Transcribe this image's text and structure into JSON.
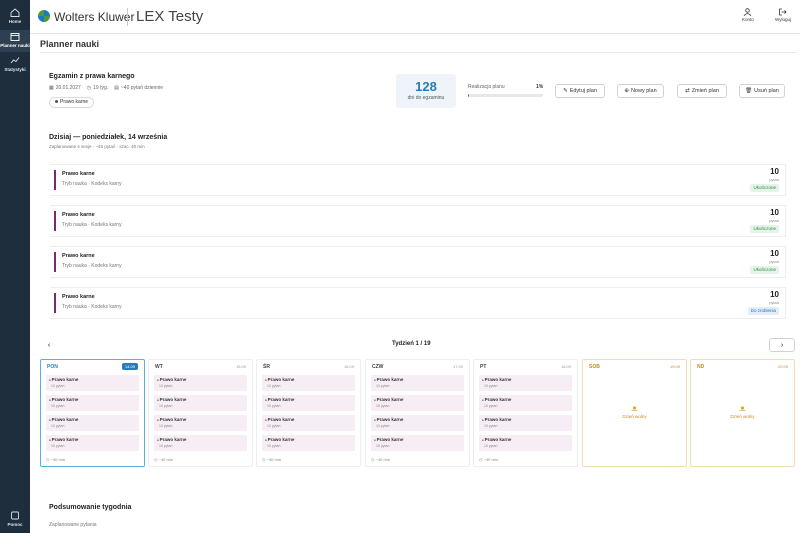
{
  "sidebar": {
    "items": [
      {
        "label": "Home",
        "icon": "home-icon"
      },
      {
        "label": "Planner nauki",
        "icon": "calendar-icon"
      },
      {
        "label": "Statystyki",
        "icon": "chart-line-icon"
      }
    ],
    "help": {
      "label": "Pomoc",
      "icon": "help-icon"
    }
  },
  "header": {
    "brand": "Wolters Kluwer",
    "app_title": "LEX Testy",
    "account_label": "Konto",
    "logout_label": "Wyloguj"
  },
  "page": {
    "title": "Planner nauki"
  },
  "exam": {
    "title": "Egzamin z prawa karnego",
    "date": "20.01.2027",
    "weeks": "19 tyg.",
    "per_day": "~40 pytań dziennie",
    "tag": "Prawo karne",
    "days_left": "128",
    "days_label": "dni do egzaminu",
    "progress_label": "Realizacja planu",
    "progress_text": "1%",
    "progress_value": 1,
    "buttons": {
      "edit": "Edytuj plan",
      "new": "Nowy plan",
      "change": "Zmień plan",
      "delete": "Usuń plan"
    }
  },
  "today": {
    "title": "Dzisiaj — poniedziałek, 14 września",
    "subtitle": "Zaplanowane 4 sesje · ~40 pytań · szac. 40 min",
    "sessions": [
      {
        "title": "Prawo karne",
        "sub": "Tryb nauka · Kodeks karny",
        "count": "10",
        "unit": "pytań",
        "status": "Ukończone",
        "state": "done"
      },
      {
        "title": "Prawo karne",
        "sub": "Tryb nauka · Kodeks karny",
        "count": "10",
        "unit": "pytań",
        "status": "Ukończone",
        "state": "done"
      },
      {
        "title": "Prawo karne",
        "sub": "Tryb nauka · Kodeks karny",
        "count": "10",
        "unit": "pytań",
        "status": "Ukończone",
        "state": "done"
      },
      {
        "title": "Prawo karne",
        "sub": "Tryb nauka · Kodeks karny",
        "count": "10",
        "unit": "pytań",
        "status": "Do zrobienia",
        "state": "todo"
      }
    ]
  },
  "week": {
    "label": "Tydzień 1 / 19",
    "prev": "‹",
    "next": "›",
    "days": [
      {
        "name": "PON",
        "date": "14.09",
        "time": "~40 min",
        "sessions": [
          {
            "title": "Prawo karne",
            "sub": "10 pytań"
          },
          {
            "title": "Prawo karne",
            "sub": "10 pytań"
          },
          {
            "title": "Prawo karne",
            "sub": "10 pytań"
          },
          {
            "title": "Prawo karne",
            "sub": "10 pytań"
          }
        ]
      },
      {
        "name": "WT",
        "date": "15.09",
        "time": "~40 min",
        "sessions": [
          {
            "title": "Prawo karne",
            "sub": "10 pytań"
          },
          {
            "title": "Prawo karne",
            "sub": "10 pytań"
          },
          {
            "title": "Prawo karne",
            "sub": "10 pytań"
          },
          {
            "title": "Prawo karne",
            "sub": "10 pytań"
          }
        ]
      },
      {
        "name": "ŚR",
        "date": "16.09",
        "time": "~40 min",
        "sessions": [
          {
            "title": "Prawo karne",
            "sub": "10 pytań"
          },
          {
            "title": "Prawo karne",
            "sub": "10 pytań"
          },
          {
            "title": "Prawo karne",
            "sub": "10 pytań"
          },
          {
            "title": "Prawo karne",
            "sub": "10 pytań"
          }
        ]
      },
      {
        "name": "CZW",
        "date": "17.09",
        "time": "~40 min",
        "sessions": [
          {
            "title": "Prawo karne",
            "sub": "10 pytań"
          },
          {
            "title": "Prawo karne",
            "sub": "10 pytań"
          },
          {
            "title": "Prawo karne",
            "sub": "10 pytań"
          },
          {
            "title": "Prawo karne",
            "sub": "10 pytań"
          }
        ]
      },
      {
        "name": "PT",
        "date": "18.09",
        "time": "~40 min",
        "sessions": [
          {
            "title": "Prawo karne",
            "sub": "10 pytań"
          },
          {
            "title": "Prawo karne",
            "sub": "10 pytań"
          },
          {
            "title": "Prawo karne",
            "sub": "10 pytań"
          },
          {
            "title": "Prawo karne",
            "sub": "10 pytań"
          }
        ]
      },
      {
        "name": "SOB",
        "date": "19.09",
        "free": "Dzień wolny"
      },
      {
        "name": "ND",
        "date": "20.09",
        "free": "Dzień wolny"
      }
    ]
  },
  "summary": {
    "title": "Podsumowanie tygodnia",
    "subtitle": "Zaplanowane pytania"
  }
}
